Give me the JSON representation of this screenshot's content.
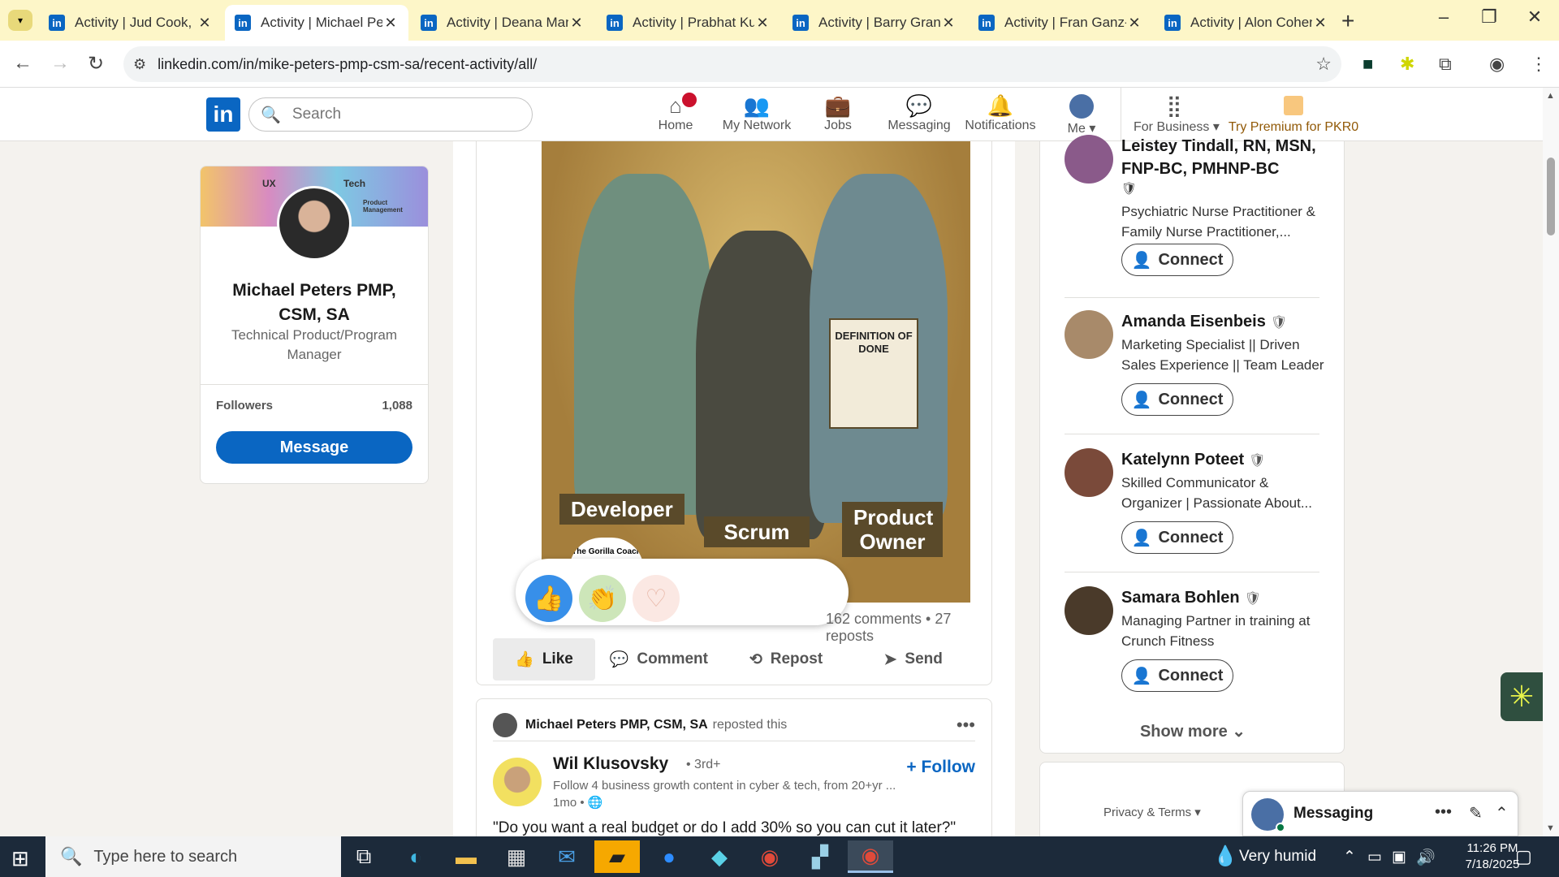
{
  "browser": {
    "tabs": [
      {
        "title": "Activity | Jud Cook, P",
        "active": false
      },
      {
        "title": "Activity | Michael Pet",
        "active": true
      },
      {
        "title": "Activity | Deana Man",
        "active": false
      },
      {
        "title": "Activity | Prabhat Kur",
        "active": false
      },
      {
        "title": "Activity | Barry Grand",
        "active": false
      },
      {
        "title": "Activity | Fran Ganz-L",
        "active": false
      },
      {
        "title": "Activity | Alon Cohen",
        "active": false
      }
    ],
    "url": "linkedin.com/in/mike-peters-pmp-csm-sa/recent-activity/all/"
  },
  "header": {
    "logo": "in",
    "search_placeholder": "Search",
    "nav": [
      {
        "label": "Home",
        "icon": "home-icon",
        "glyph": "⌂",
        "badge": true
      },
      {
        "label": "My Network",
        "icon": "network-icon",
        "glyph": "👥",
        "badge": false
      },
      {
        "label": "Jobs",
        "icon": "briefcase-icon",
        "glyph": "💼",
        "badge": false
      },
      {
        "label": "Messaging",
        "icon": "chat-icon",
        "glyph": "💬",
        "badge": false
      },
      {
        "label": "Notifications",
        "icon": "bell-icon",
        "glyph": "🔔",
        "badge": false
      }
    ],
    "me_label": "Me ▾",
    "for_business": "For Business ▾",
    "premium": "Try Premium for PKR0"
  },
  "profile": {
    "banner_labels": [
      "UX",
      "Tech",
      "Product Management"
    ],
    "name": "Michael Peters PMP, CSM, SA",
    "title": "Technical Product/Program Manager",
    "followers_label": "Followers",
    "followers_count": "1,088",
    "message_button": "Message"
  },
  "post": {
    "image_labels": {
      "developer": "Developer",
      "scrum": "Scrum Master",
      "po": "Product Owner",
      "dod": "DEFINITION OF DONE",
      "logo": "The Gorilla Coach"
    },
    "stats": "162 comments • 27 reposts",
    "actions": [
      "Like",
      "Comment",
      "Repost",
      "Send"
    ]
  },
  "post2": {
    "reposter": "Michael Peters PMP, CSM, SA",
    "reposted_text": "reposted this",
    "author": "Wil Klusovsky",
    "degree": "• 3rd+",
    "subtitle": "Follow 4 business growth content in cyber & tech, from 20+yr ...",
    "time": "1mo •",
    "follow": "+ Follow",
    "text": "\"Do you want a real budget or do I add 30% so you can cut it later?\""
  },
  "suggestions": [
    {
      "name": "Leistey Tindall, RN, MSN, FNP-BC, PMHNP-BC",
      "desc": "Psychiatric Nurse Practitioner & Family Nurse Practitioner,...",
      "color": "#8a5a8a"
    },
    {
      "name": "Amanda Eisenbeis",
      "desc": "Marketing Specialist || Driven Sales Experience || Team Leader",
      "color": "#a88a6a"
    },
    {
      "name": "Katelynn Poteet",
      "desc": "Skilled Communicator & Organizer | Passionate About...",
      "color": "#7a4a3a"
    },
    {
      "name": "Samara Bohlen",
      "desc": "Managing Partner in training at Crunch Fitness",
      "color": "#4a3a2a"
    }
  ],
  "connect_label": "Connect",
  "show_more": "Show more",
  "privacy": "Privacy & Terms ▾",
  "messaging_label": "Messaging",
  "taskbar": {
    "search_placeholder": "Type here to search",
    "weather": "Very humid",
    "time": "11:26 PM",
    "date": "7/18/2025"
  },
  "colors": {
    "brand": "#0a66c2",
    "tabbar": "#fdf6c8"
  }
}
